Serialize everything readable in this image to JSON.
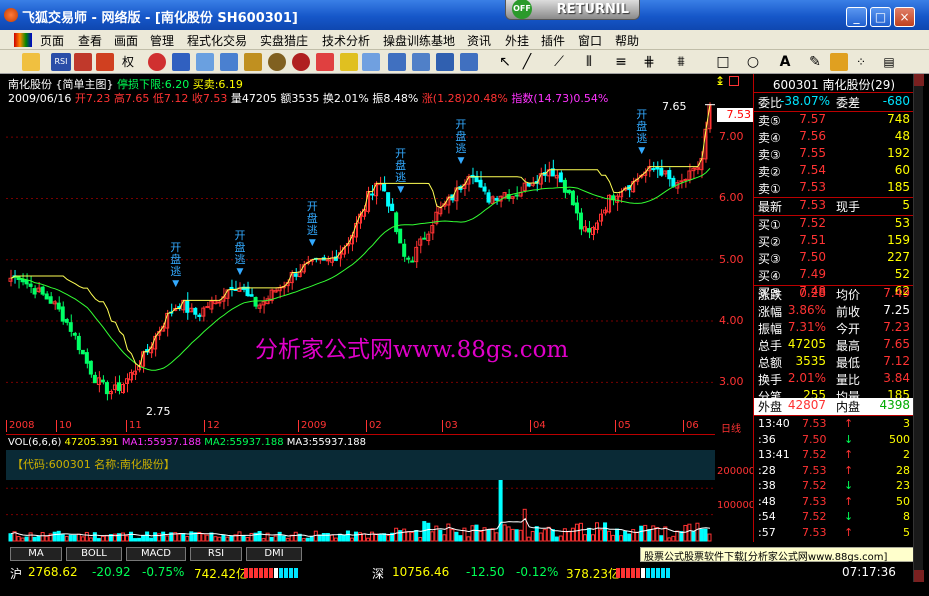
{
  "window": {
    "title": "飞狐交易师 - 网络版 - [南化股份 SH600301]",
    "returnil": {
      "badge": "OFF",
      "label": "RETURNIL"
    },
    "controls": [
      "_",
      "□",
      "×"
    ]
  },
  "menu": [
    "页面",
    "查看",
    "画面",
    "管理",
    "程式化交易",
    "实盘猎庄",
    "技术分析",
    "操盘训练基地",
    "资讯",
    "外挂",
    "插件",
    "窗口",
    "帮助"
  ],
  "toolbar": {
    "rsi_label": "RSI",
    "quan_label": "权"
  },
  "chart": {
    "header_line1": {
      "name": "南化股份",
      "mode": "{简单主图}",
      "stop_loss": "停损下限:6.20",
      "buy_sell": "买卖:6.19"
    },
    "header_line2": {
      "date": "2009/06/16",
      "open": "开7.23",
      "high": "高7.65",
      "low": "低7.12",
      "close": "收7.53",
      "volume": "量47205",
      "amount": "额3535",
      "turnover": "换2.01%",
      "amplitude": "振8.48%",
      "change": "涨(1.28)20.48%",
      "index": "指数(14.73)0.54%"
    },
    "high_label": "7.65",
    "low_label": "2.75",
    "current_price_tag": "7.53",
    "signal_text": "开盘逃",
    "watermark": "分析家公式网www.88gs.com",
    "date_labels": [
      "2008",
      "10",
      "11",
      "12",
      "2009",
      "02",
      "03",
      "04",
      "05",
      "06"
    ],
    "daily_label": "日线"
  },
  "chart_data": {
    "type": "candlestick",
    "title": "南化股份 SH600301",
    "y_ticks": [
      3.0,
      4.0,
      5.0,
      6.0,
      7.0
    ],
    "ylim": [
      2.5,
      7.9
    ],
    "current_price": 7.53,
    "period_high": 7.65,
    "period_low": 2.75,
    "signals_at": [
      0.235,
      0.325,
      0.43,
      0.555,
      0.645,
      0.905
    ],
    "close_path": [
      4.7,
      4.75,
      4.6,
      4.5,
      4.4,
      4.3,
      4.1,
      3.9,
      3.6,
      3.3,
      3.05,
      2.9,
      2.85,
      2.95,
      3.1,
      3.3,
      3.5,
      3.75,
      4.0,
      4.2,
      4.3,
      4.15,
      4.1,
      4.25,
      4.3,
      4.45,
      4.6,
      4.55,
      4.35,
      4.25,
      4.35,
      4.5,
      4.6,
      4.75,
      4.85,
      4.9,
      4.95,
      4.95,
      5.05,
      5.2,
      5.4,
      5.7,
      6.05,
      6.3,
      6.1,
      5.6,
      5.05,
      5.0,
      5.25,
      5.5,
      5.75,
      5.9,
      6.05,
      6.25,
      6.5,
      6.15,
      6.0,
      6.05,
      6.1,
      6.05,
      6.15,
      6.3,
      6.35,
      6.5,
      6.4,
      6.2,
      5.9,
      5.5,
      5.4,
      5.7,
      5.95,
      6.1,
      6.2,
      6.25,
      6.4,
      6.45,
      6.5,
      6.35,
      6.15,
      6.3,
      6.4,
      6.6,
      7.53
    ],
    "volume": {
      "indicator": "VOL(6,6,6)",
      "current": "47205.391",
      "ma1": "MA1:55937.188",
      "ma2": "MA2:55937.188",
      "ma3": "MA3:55937.188",
      "y_ticks": [
        "200000",
        "100000"
      ]
    },
    "grid": true
  },
  "codebar": "【代码:600301 名称:南化股份】",
  "tabs": [
    "MA",
    "BOLL",
    "MACD",
    "RSI",
    "DMI"
  ],
  "ad": "股票公式股票软件下载[分析家公式网www.88gs.com]",
  "status": {
    "sh": {
      "label": "沪",
      "value": "2768.62",
      "change": "-20.92",
      "pct": "-0.75%",
      "amount": "742.42亿"
    },
    "sz": {
      "label": "深",
      "value": "10756.46",
      "change": "-12.50",
      "pct": "-0.12%",
      "amount": "378.23亿"
    },
    "time": "07:17:36"
  },
  "quote": {
    "header": "600301  南化股份(29)",
    "weibi": {
      "label": "委比",
      "value": "-38.07%",
      "label2": "委差",
      "value2": "-680"
    },
    "asks": [
      {
        "label": "卖⑤",
        "price": "7.57",
        "vol": "748"
      },
      {
        "label": "卖④",
        "price": "7.56",
        "vol": "48"
      },
      {
        "label": "卖③",
        "price": "7.55",
        "vol": "192"
      },
      {
        "label": "卖②",
        "price": "7.54",
        "vol": "60"
      },
      {
        "label": "卖①",
        "price": "7.53",
        "vol": "185"
      }
    ],
    "latest": {
      "label": "最新",
      "price": "7.53",
      "label2": "现手",
      "vol": "5"
    },
    "bids": [
      {
        "label": "买①",
        "price": "7.52",
        "vol": "53"
      },
      {
        "label": "买②",
        "price": "7.51",
        "vol": "159"
      },
      {
        "label": "买③",
        "price": "7.50",
        "vol": "227"
      },
      {
        "label": "买④",
        "price": "7.49",
        "vol": "52"
      },
      {
        "label": "买⑤",
        "price": "7.48",
        "vol": "62"
      }
    ],
    "stats": [
      {
        "l1": "涨跌",
        "v1": "0.28",
        "l2": "均价",
        "v2": "7.49"
      },
      {
        "l1": "涨幅",
        "v1": "3.86%",
        "l2": "前收",
        "v2": "7.25"
      },
      {
        "l1": "振幅",
        "v1": "7.31%",
        "l2": "今开",
        "v2": "7.23"
      },
      {
        "l1": "总手",
        "v1": "47205",
        "l2": "最高",
        "v2": "7.65"
      },
      {
        "l1": "总额",
        "v1": "3535",
        "l2": "最低",
        "v2": "7.12"
      },
      {
        "l1": "换手",
        "v1": "2.01%",
        "l2": "量比",
        "v2": "3.84"
      },
      {
        "l1": "分笔",
        "v1": "255",
        "l2": "均量",
        "v2": "185"
      }
    ],
    "outer_inner": {
      "l1": "外盘",
      "v1": "42807",
      "l2": "内盘",
      "v2": "4398"
    },
    "ticks": [
      {
        "time": "13:40",
        "price": "7.53",
        "dir": "↑",
        "vol": "3"
      },
      {
        "time": ":36",
        "price": "7.50",
        "dir": "↓",
        "vol": "500"
      },
      {
        "time": "13:41",
        "price": "7.52",
        "dir": "↑",
        "vol": "2"
      },
      {
        "time": ":28",
        "price": "7.53",
        "dir": "↑",
        "vol": "28"
      },
      {
        "time": ":38",
        "price": "7.52",
        "dir": "↓",
        "vol": "23"
      },
      {
        "time": ":48",
        "price": "7.53",
        "dir": "↑",
        "vol": "50"
      },
      {
        "time": ":54",
        "price": "7.52",
        "dir": "↓",
        "vol": "8"
      },
      {
        "time": ":57",
        "price": "7.53",
        "dir": "↑",
        "vol": "5"
      }
    ]
  }
}
